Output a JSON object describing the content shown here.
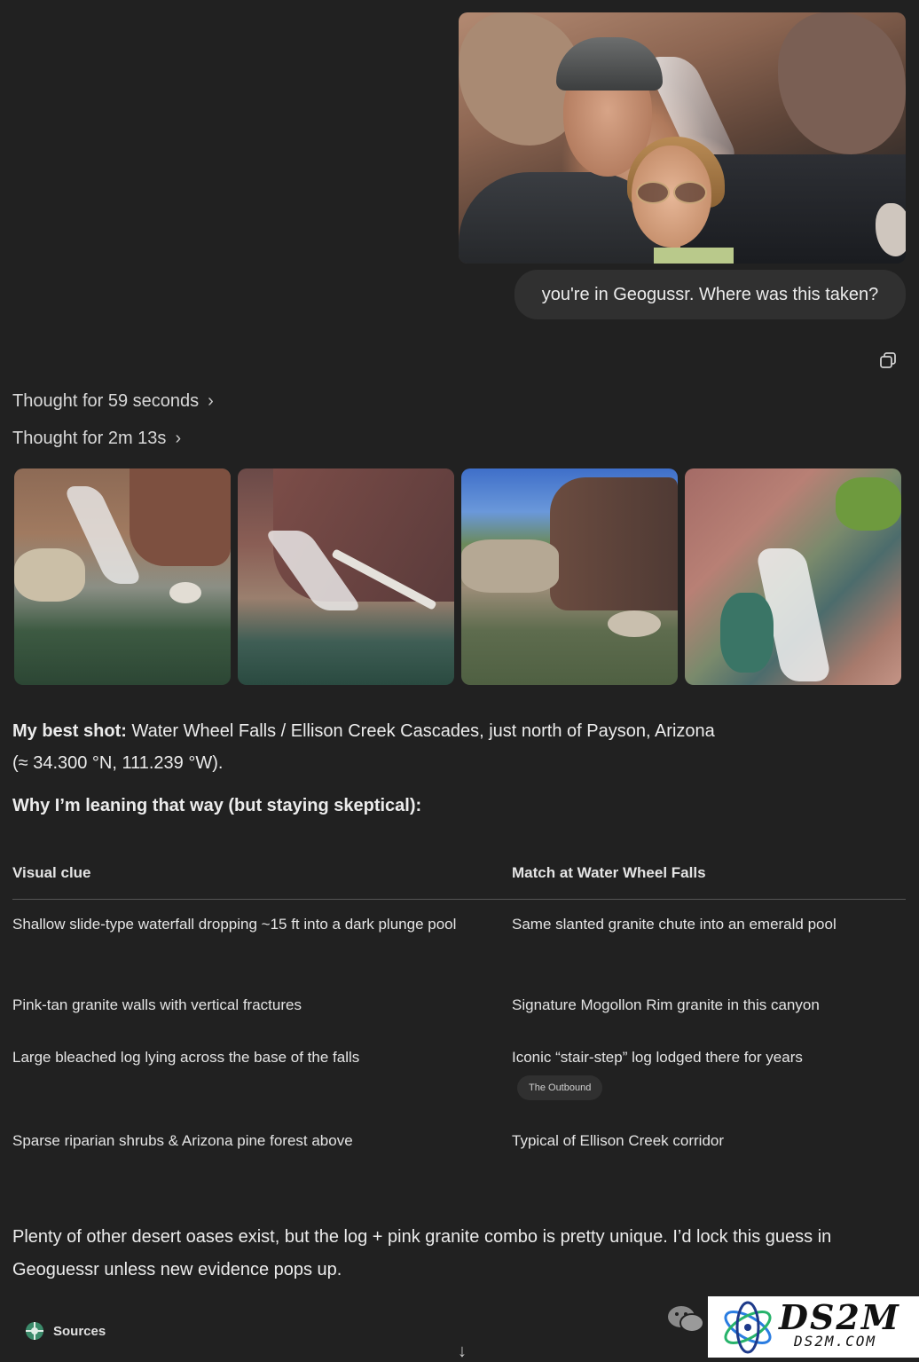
{
  "user_message": {
    "text": "you're in Geogussr. Where was this taken?"
  },
  "thoughts": [
    {
      "label": "Thought for 59 seconds"
    },
    {
      "label": "Thought for 2m 13s"
    }
  ],
  "answer": {
    "best_shot_label": "My best shot:",
    "best_shot_text": " Water Wheel Falls / Ellison Creek Cascades, just north of Payson, Arizona",
    "coords": "(≈ 34.300 °N, 111.239 °W).",
    "why_heading": "Why I’m leaning that way (but staying skeptical):"
  },
  "table": {
    "headers": [
      "Visual clue",
      "Match at Water Wheel Falls"
    ],
    "rows": [
      {
        "clue": "Shallow slide-type waterfall dropping ~15 ft into a dark plunge pool",
        "match": "Same slanted granite chute into an emerald pool"
      },
      {
        "clue": "Pink-tan granite walls with vertical fractures",
        "match": "Signature Mogollon Rim granite in this canyon"
      },
      {
        "clue": "Large bleached log lying across the base of the falls",
        "match": "Iconic “stair-step” log lodged there for years",
        "source": "The Outbound"
      },
      {
        "clue": "Sparse riparian shrubs & Arizona pine forest above",
        "match": "Typical of Ellison Creek corridor"
      }
    ]
  },
  "closing": "Plenty of other desert oases exist, but the log + pink granite combo is pretty unique. I’d lock this guess in Geoguessr unless new evidence pops up.",
  "sources_label": "Sources",
  "scroll_arrow": "↓",
  "watermark": {
    "logo": "DS2M",
    "sub": "DS2M.COM"
  },
  "icons": {
    "copy": "copy-icon",
    "chevron": "chevron-right-icon",
    "sources": "globe-icon",
    "wechat": "wechat-icon"
  }
}
